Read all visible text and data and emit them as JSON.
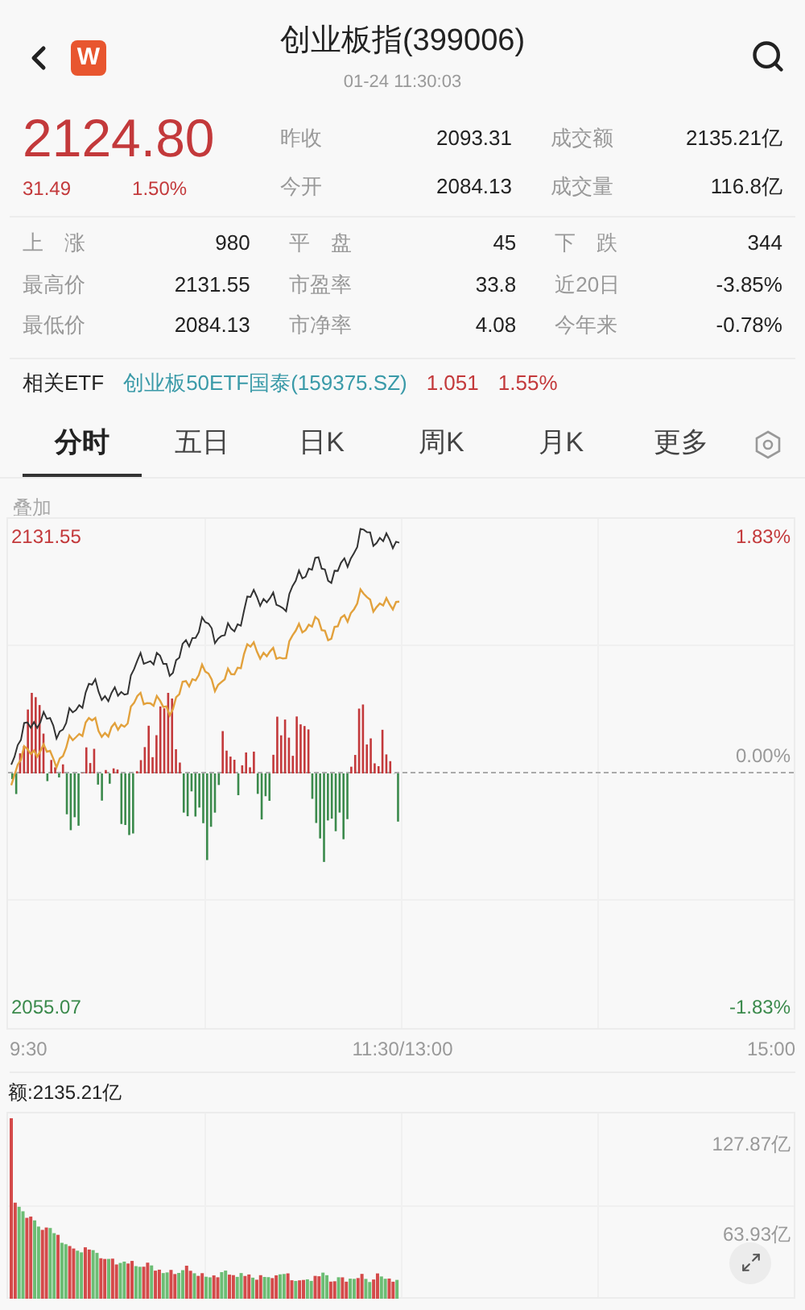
{
  "header": {
    "title": "创业板指(399006)",
    "time": "01-24 11:30:03",
    "badge": "W"
  },
  "quote": {
    "price": "2124.80",
    "change": "31.49",
    "change_pct": "1.50%"
  },
  "top_stats": [
    {
      "label": "昨收",
      "value": "2093.31"
    },
    {
      "label": "成交额",
      "value": "2135.21亿"
    },
    {
      "label": "今开",
      "value": "2084.13"
    },
    {
      "label": "成交量",
      "value": "116.8亿"
    }
  ],
  "stats": [
    {
      "label": "上　涨",
      "value": "980"
    },
    {
      "label": "平　盘",
      "value": "45"
    },
    {
      "label": "下　跌",
      "value": "344"
    },
    {
      "label": "最高价",
      "value": "2131.55"
    },
    {
      "label": "市盈率",
      "value": "33.8"
    },
    {
      "label": "近20日",
      "value": "-3.85%"
    },
    {
      "label": "最低价",
      "value": "2084.13"
    },
    {
      "label": "市净率",
      "value": "4.08"
    },
    {
      "label": "今年来",
      "value": "-0.78%"
    }
  ],
  "related_etf": {
    "label": "相关ETF",
    "name": "创业板50ETF国泰(159375.SZ)",
    "price": "1.051",
    "change_pct": "1.55%"
  },
  "tabs": [
    {
      "label": "分时",
      "selected": true
    },
    {
      "label": "五日",
      "selected": false
    },
    {
      "label": "日K",
      "selected": false
    },
    {
      "label": "周K",
      "selected": false
    },
    {
      "label": "月K",
      "selected": false
    },
    {
      "label": "更多",
      "selected": false
    }
  ],
  "overlay_label": "叠加",
  "intraday": {
    "high": "2131.55",
    "low": "2055.07",
    "high_pct": "1.83%",
    "zero_pct": "0.00%",
    "low_pct": "-1.83%",
    "times": [
      "9:30",
      "11:30/13:00",
      "15:00"
    ]
  },
  "turnover": {
    "label": "额:2135.21亿",
    "top": "127.87亿",
    "mid": "63.93亿"
  }
}
